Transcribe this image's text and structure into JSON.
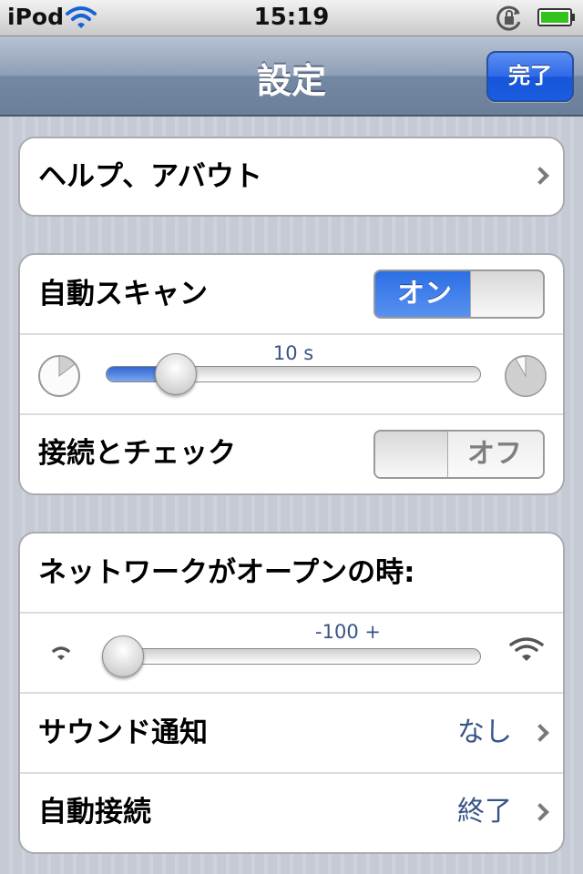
{
  "status": {
    "carrier": "iPod",
    "time": "15:19",
    "icons": [
      "wifi-icon",
      "rotation-lock-icon",
      "battery-icon"
    ]
  },
  "navbar": {
    "title": "設定",
    "done_label": "完了"
  },
  "section1": {
    "help_label": "ヘルプ、アバウト"
  },
  "section2": {
    "auto_scan_label": "自動スキャン",
    "auto_scan_switch": {
      "state": "on",
      "text": "オン"
    },
    "interval_slider": {
      "value_text": "10 s",
      "fraction": 0.18,
      "min_icon": "timer-short-icon",
      "max_icon": "timer-long-icon"
    },
    "connect_check_label": "接続とチェック",
    "connect_check_switch": {
      "state": "off",
      "text": "オフ"
    }
  },
  "section3": {
    "network_open_label": "ネットワークがオープンの時:",
    "signal_slider": {
      "value_text": "-100 +",
      "fraction": 0.0,
      "min_icon": "weak-signal-icon",
      "max_icon": "strong-signal-icon"
    },
    "sound_label": "サウンド通知",
    "sound_value": "なし",
    "auto_connect_label": "自動接続",
    "auto_connect_value": "終了"
  },
  "colors": {
    "accent_blue": "#2f6ae6",
    "value_text": "#385487",
    "nav_bar": "#7388a3"
  }
}
